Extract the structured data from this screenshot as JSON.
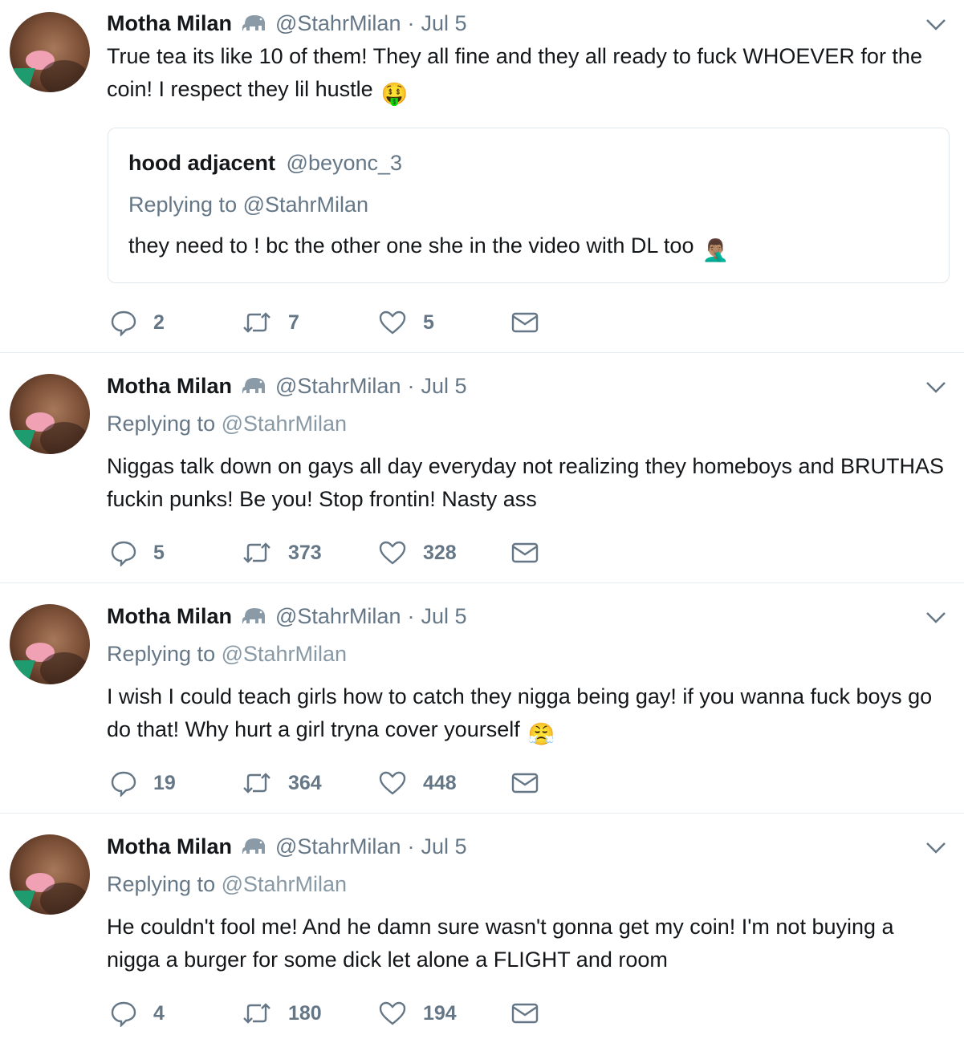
{
  "tweets": [
    {
      "name": "Motha Milan",
      "handle": "@StahrMilan",
      "separator": "·",
      "date": "Jul 5",
      "replying_prefix": "",
      "replying_handle": "",
      "text": "True tea its like 10 of them! They all fine and they all ready to fuck WHOEVER for the coin! I respect they lil hustle",
      "emoji": "🤑",
      "quote": {
        "name": "hood adjacent",
        "handle": "@beyonc_3",
        "replying_prefix": "Replying to",
        "replying_handle": "@StahrMilan",
        "text": "they need to ! bc the other one she in the video with DL too",
        "emoji": "🤦🏽‍♂️"
      },
      "replies": "2",
      "retweets": "7",
      "likes": "5"
    },
    {
      "name": "Motha Milan",
      "handle": "@StahrMilan",
      "separator": "·",
      "date": "Jul 5",
      "replying_prefix": "Replying to",
      "replying_handle": "@StahrMilan",
      "text": "Niggas talk down on gays all day everyday not realizing they homeboys and BRUTHAS fuckin punks! Be you! Stop frontin! Nasty ass",
      "emoji": "",
      "replies": "5",
      "retweets": "373",
      "likes": "328"
    },
    {
      "name": "Motha Milan",
      "handle": "@StahrMilan",
      "separator": "·",
      "date": "Jul 5",
      "replying_prefix": "Replying to",
      "replying_handle": "@StahrMilan",
      "text": "I wish I could teach girls how to catch they nigga being gay! if you wanna fuck boys go do that! Why hurt a girl tryna cover yourself",
      "emoji": "😤",
      "replies": "19",
      "retweets": "364",
      "likes": "448"
    },
    {
      "name": "Motha Milan",
      "handle": "@StahrMilan",
      "separator": "·",
      "date": "Jul 5",
      "replying_prefix": "Replying to",
      "replying_handle": "@StahrMilan",
      "text": "He couldn't fool me! And he damn sure wasn't gonna get my coin! I'm not buying a nigga a burger for some dick let alone a FLIGHT and room",
      "emoji": "",
      "replies": "4",
      "retweets": "180",
      "likes": "194"
    }
  ],
  "icons": {
    "verified_emoji": "elephant-icon",
    "menu": "chevron-down-icon",
    "reply": "reply-bubble-icon",
    "retweet": "retweet-icon",
    "like": "heart-icon",
    "dm": "envelope-icon"
  },
  "colors": {
    "text": "#14171a",
    "secondary": "#657786",
    "border": "#e6ecf0"
  }
}
